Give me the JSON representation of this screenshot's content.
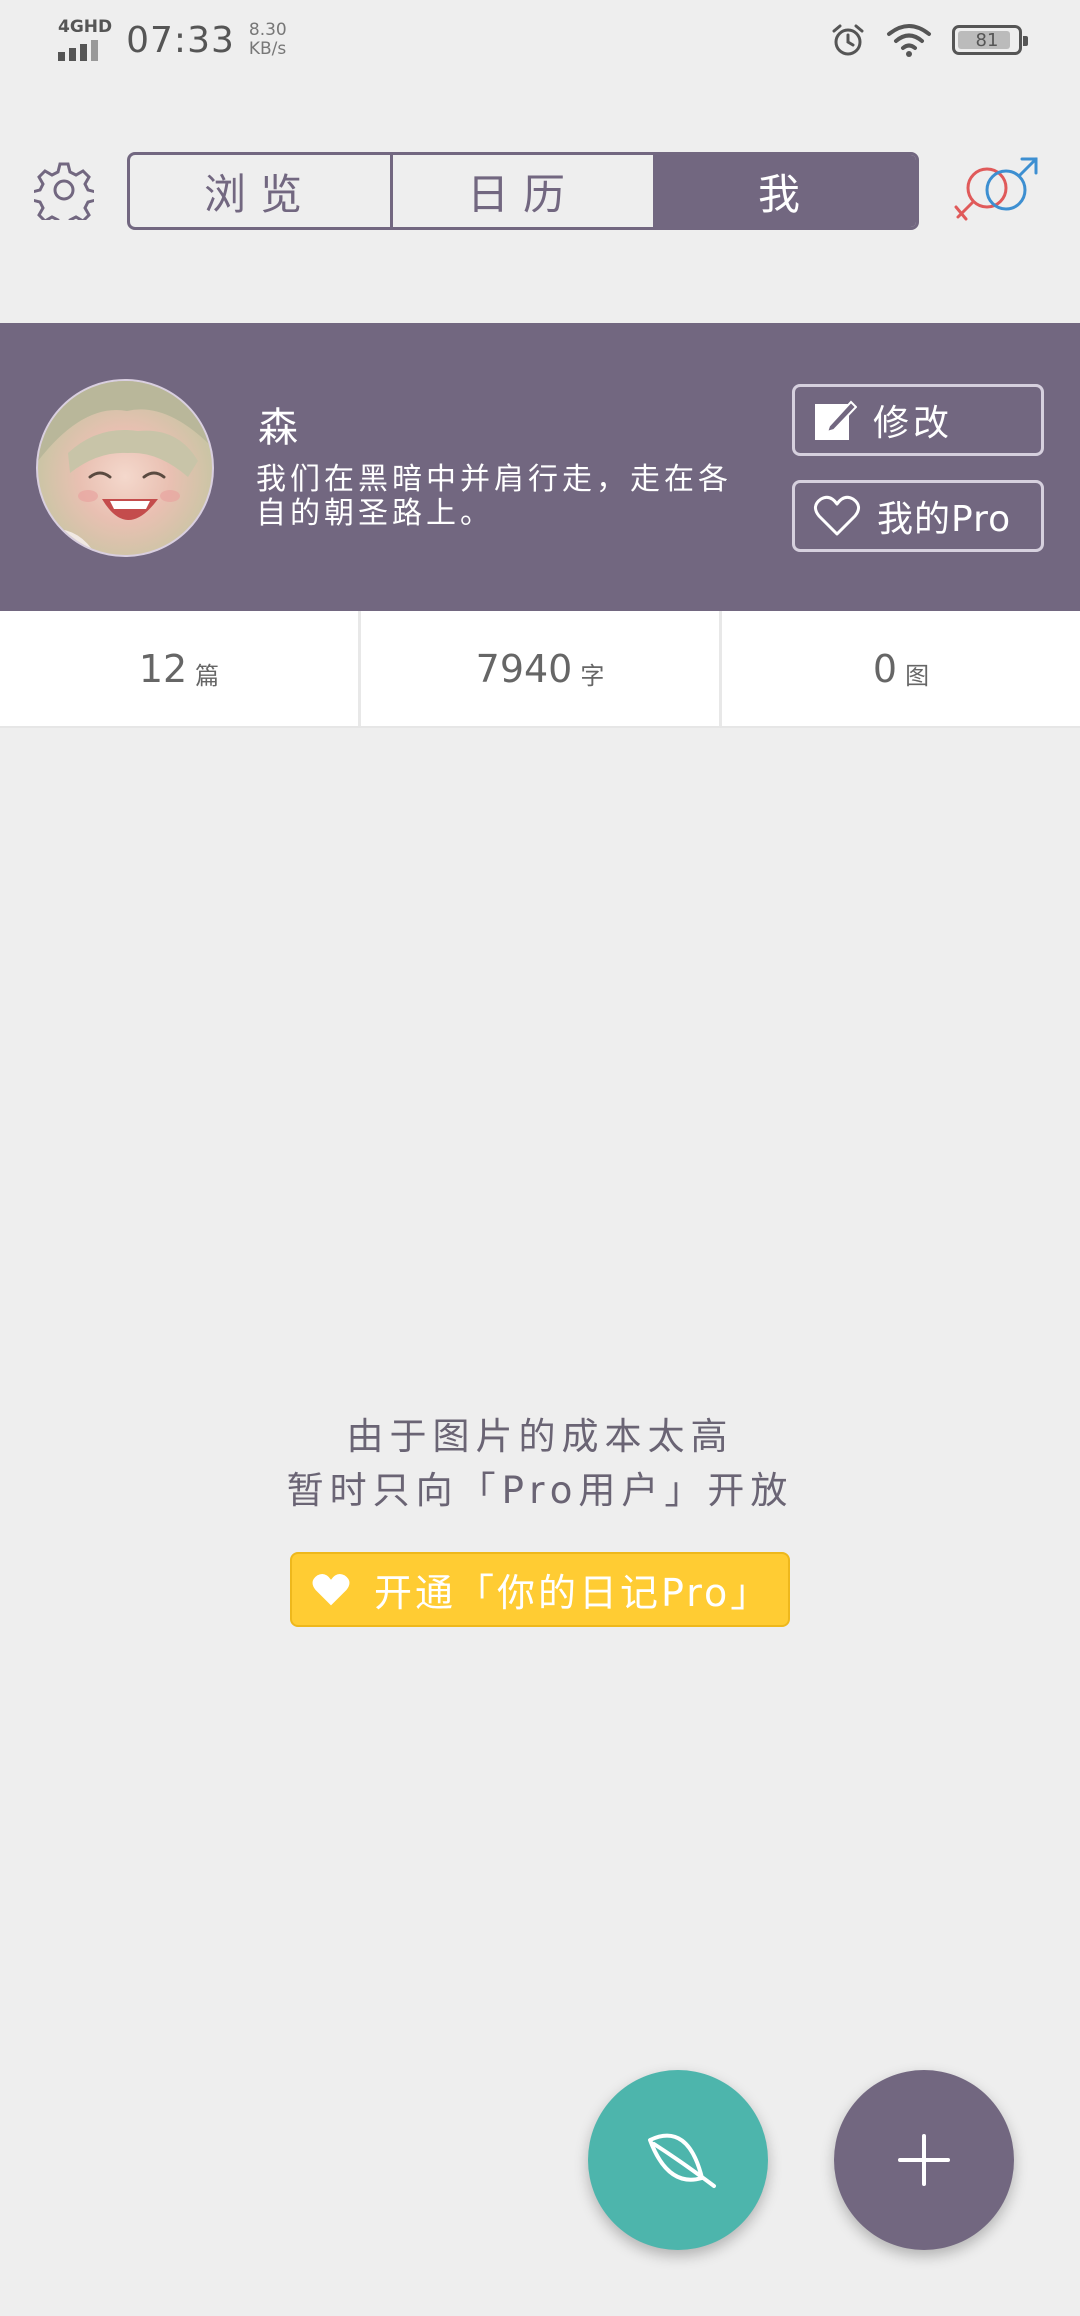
{
  "status_bar": {
    "network": "4GHD",
    "time": "07:33",
    "speed_value": "8.30",
    "speed_unit": "KB/s",
    "battery": "81"
  },
  "header": {
    "tabs": [
      {
        "label": "浏览",
        "active": false
      },
      {
        "label": "日历",
        "active": false
      },
      {
        "label": "我",
        "active": true
      }
    ]
  },
  "profile": {
    "name": "森",
    "bio": "我们在黑暗中并肩行走，走在各自的朝圣路上。",
    "edit_label": "修改",
    "pro_label": "我的Pro"
  },
  "stats": [
    {
      "value": "12",
      "unit": "篇"
    },
    {
      "value": "7940",
      "unit": "字"
    },
    {
      "value": "0",
      "unit": "图"
    }
  ],
  "notice": {
    "line1": "由于图片的成本太高",
    "line2": "暂时只向「Pro用户」开放",
    "button_label": "开通「你的日记Pro」"
  },
  "colors": {
    "primary": "#726780",
    "background": "#eeeeee",
    "accent_yellow": "#ffcc33",
    "fab_teal": "#4db5ac"
  }
}
